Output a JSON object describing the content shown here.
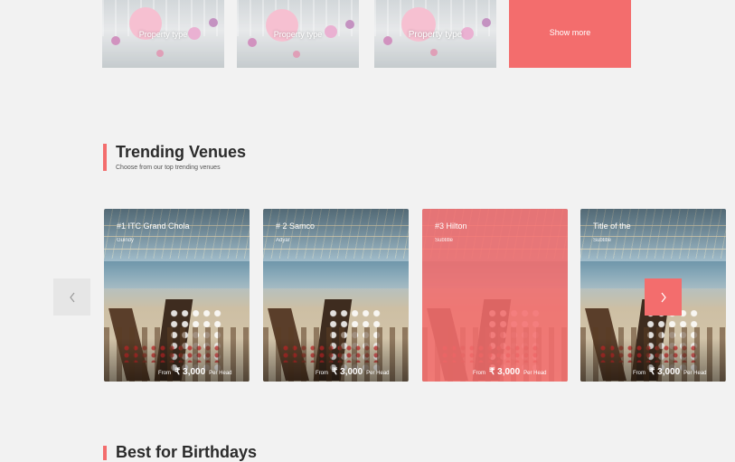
{
  "property_types": [
    {
      "label": "Property type"
    },
    {
      "label": "Property type"
    },
    {
      "label": "Property type"
    }
  ],
  "show_more": "Show more",
  "trending": {
    "title": "Trending Venues",
    "subtitle": "Choose from our top trending venues"
  },
  "venues": [
    {
      "title": "#1 ITC Grand Chola",
      "subtitle": "Guindy",
      "from": "From",
      "price": "₹ 3,000",
      "per": "Per Head"
    },
    {
      "title": "# 2 Samco",
      "subtitle": "Adyar",
      "from": "From",
      "price": "₹ 3,000",
      "per": "Per Head"
    },
    {
      "title": "#3 Hilton",
      "subtitle": "Subtitle",
      "from": "From",
      "price": "₹ 3,000",
      "per": "Per Head"
    },
    {
      "title": "Title of the",
      "subtitle": "Subtitle",
      "from": "From",
      "price": "₹ 3,000",
      "per": "Per Head"
    }
  ],
  "birthdays": {
    "title": "Best for Birthdays"
  },
  "icons": {
    "prev": "chevron-left-icon",
    "next": "chevron-right-icon"
  },
  "colors": {
    "accent": "#f36d6d",
    "background": "#f2f2f2",
    "heading": "#2b2b2b"
  }
}
